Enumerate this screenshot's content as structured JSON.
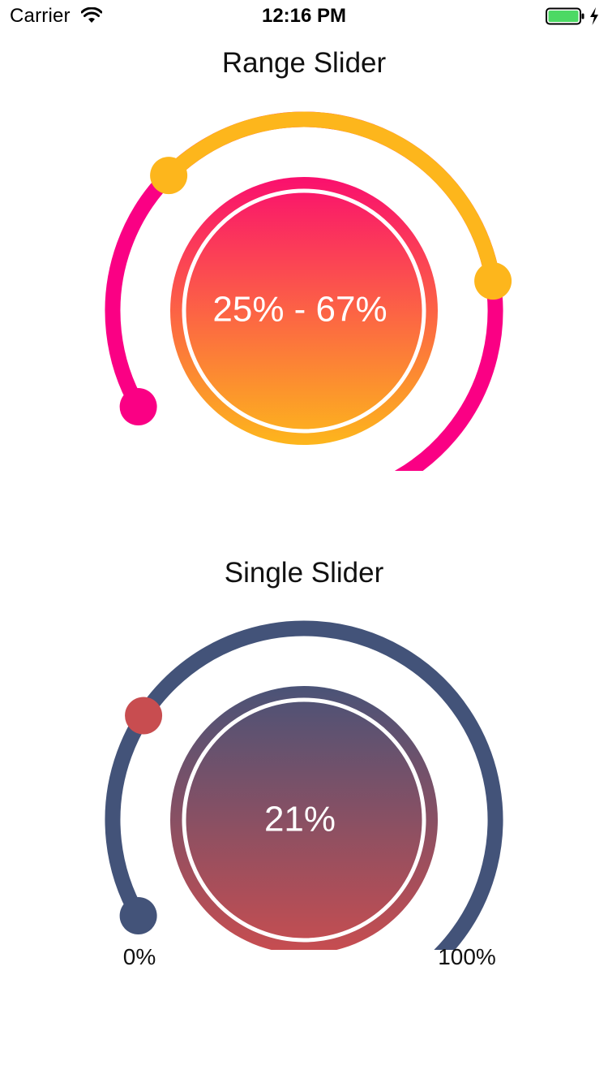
{
  "status_bar": {
    "carrier": "Carrier",
    "time": "12:16 PM",
    "wifi_icon": "wifi-icon",
    "battery_icon": "battery-icon",
    "charging_icon": "charging-bolt-icon"
  },
  "range_slider": {
    "title": "Range Slider",
    "value_text": "25% - 67%",
    "lower_value": 0.25,
    "upper_value": 0.67,
    "colors": {
      "track": "#FA0084",
      "selected": "#FDB61C",
      "handle": "#FDB61C",
      "endpoint": "#FA0084",
      "gradient_top": "#FA0F6E",
      "gradient_bottom": "#FDB61C"
    }
  },
  "single_slider": {
    "title": "Single Slider",
    "value_text": "21%",
    "value": 0.21,
    "min_label": "0%",
    "max_label": "100%",
    "colors": {
      "track": "#435379",
      "handle": "#C84D50",
      "endpoint": "#435379",
      "gradient_top": "#4A5377",
      "gradient_bottom": "#C84D50"
    }
  }
}
